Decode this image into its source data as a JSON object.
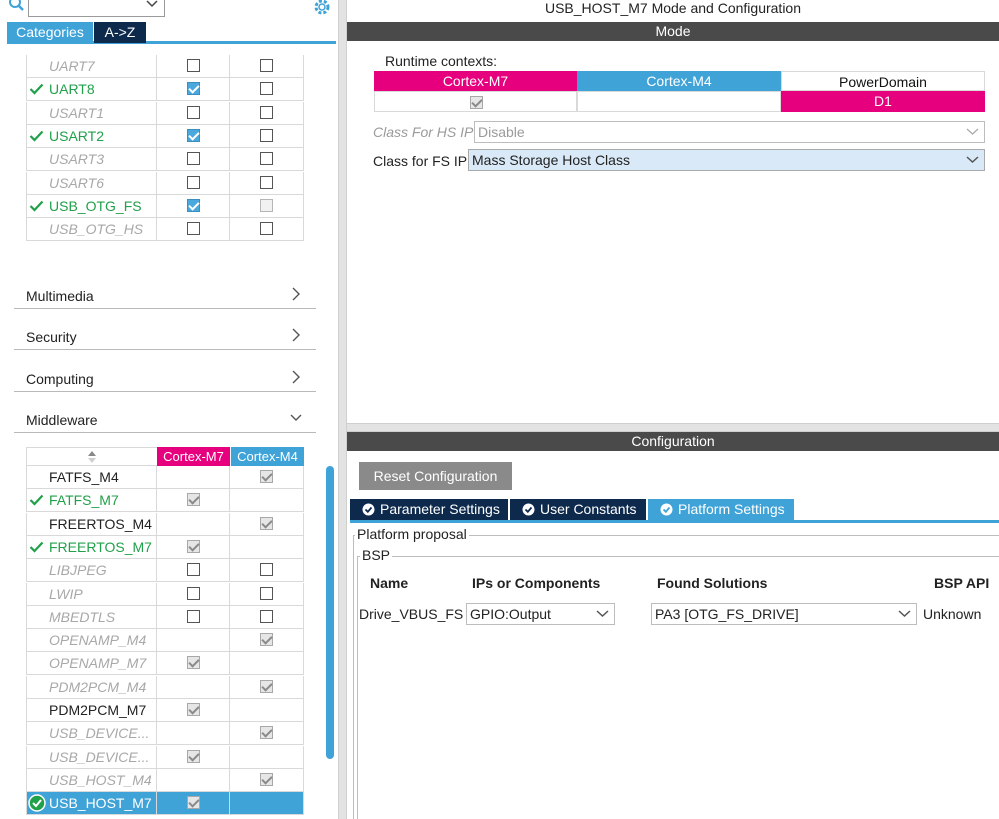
{
  "left": {
    "tabs": {
      "categories": "Categories",
      "az": "A->Z"
    },
    "connectivity_rows": [
      {
        "name": "UART7",
        "state": "disabled",
        "c1": "empty",
        "c2": "empty"
      },
      {
        "name": "UART8",
        "state": "ok",
        "c1": "checked",
        "c2": "empty"
      },
      {
        "name": "USART1",
        "state": "disabled",
        "c1": "empty",
        "c2": "empty"
      },
      {
        "name": "USART2",
        "state": "ok",
        "c1": "checked",
        "c2": "empty"
      },
      {
        "name": "USART3",
        "state": "disabled",
        "c1": "empty",
        "c2": "empty"
      },
      {
        "name": "USART6",
        "state": "disabled",
        "c1": "empty",
        "c2": "empty"
      },
      {
        "name": "USB_OTG_FS",
        "state": "ok",
        "c1": "checked",
        "c2": "faint"
      },
      {
        "name": "USB_OTG_HS",
        "state": "disabled",
        "c1": "empty",
        "c2": "empty"
      }
    ],
    "sections": [
      {
        "label": "Multimedia",
        "expanded": false
      },
      {
        "label": "Security",
        "expanded": false
      },
      {
        "label": "Computing",
        "expanded": false
      },
      {
        "label": "Middleware",
        "expanded": true
      }
    ],
    "middleware_header": {
      "c1": "Cortex-M7",
      "c2": "Cortex-M4"
    },
    "middleware_rows": [
      {
        "name": "FATFS_M4",
        "state": "normal",
        "c1": "none",
        "c2": "grey"
      },
      {
        "name": "FATFS_M7",
        "state": "ok",
        "c1": "grey",
        "c2": "none"
      },
      {
        "name": "FREERTOS_M4",
        "state": "normal",
        "c1": "none",
        "c2": "grey"
      },
      {
        "name": "FREERTOS_M7",
        "state": "ok",
        "c1": "grey",
        "c2": "none"
      },
      {
        "name": "LIBJPEG",
        "state": "disabled",
        "c1": "empty",
        "c2": "empty"
      },
      {
        "name": "LWIP",
        "state": "disabled",
        "c1": "empty",
        "c2": "empty"
      },
      {
        "name": "MBEDTLS",
        "state": "disabled",
        "c1": "empty",
        "c2": "empty"
      },
      {
        "name": "OPENAMP_M4",
        "state": "disabled",
        "c1": "none",
        "c2": "grey"
      },
      {
        "name": "OPENAMP_M7",
        "state": "disabled",
        "c1": "grey",
        "c2": "none"
      },
      {
        "name": "PDM2PCM_M4",
        "state": "disabled",
        "c1": "none",
        "c2": "grey"
      },
      {
        "name": "PDM2PCM_M7",
        "state": "normal",
        "c1": "grey",
        "c2": "none"
      },
      {
        "name": "USB_DEVICE...",
        "state": "disabled",
        "c1": "none",
        "c2": "grey"
      },
      {
        "name": "USB_DEVICE...",
        "state": "disabled",
        "c1": "grey",
        "c2": "none"
      },
      {
        "name": "USB_HOST_M4",
        "state": "disabled",
        "c1": "none",
        "c2": "grey"
      },
      {
        "name": "USB_HOST_M7",
        "state": "selected",
        "c1": "grey",
        "c2": "none"
      }
    ]
  },
  "right": {
    "title": "USB_HOST_M7 Mode and Configuration",
    "mode_header": "Mode",
    "runtime_label": "Runtime contexts:",
    "contexts": {
      "m7": "Cortex-M7",
      "m4": "Cortex-M4",
      "power": "PowerDomain",
      "d1": "D1"
    },
    "hs_label": "Class For HS IP",
    "hs_value": "Disable",
    "fs_label": "Class for FS IP",
    "fs_value": "Mass Storage Host Class",
    "config_header": "Configuration",
    "reset_button": "Reset Configuration",
    "config_tabs": {
      "params": "Parameter Settings",
      "user": "User Constants",
      "platform": "Platform Settings"
    },
    "platform_proposal": "Platform proposal",
    "bsp_group": "BSP",
    "bsp_headers": {
      "name": "Name",
      "ips": "IPs or Components",
      "found": "Found Solutions",
      "api": "BSP API"
    },
    "bsp_row": {
      "name": "Drive_VBUS_FS",
      "ip": "GPIO:Output",
      "found": "PA3 [OTG_FS_DRIVE]",
      "api": "Unknown"
    }
  },
  "colors": {
    "accent": "#3fa3d8",
    "magenta": "#e6007e",
    "navy": "#0d2a4d",
    "ok": "#21a04a"
  }
}
